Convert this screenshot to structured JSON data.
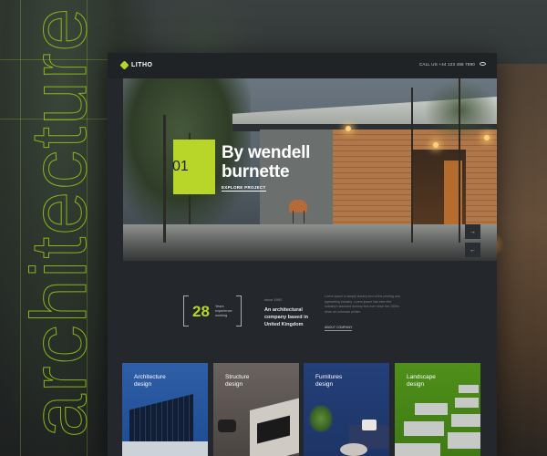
{
  "backdrop": {
    "vertical_word": "architecture"
  },
  "header": {
    "logo_text": "LITHO",
    "call_text": "CALL US +44 123 456 7890"
  },
  "hero": {
    "number": "01",
    "title_line1": "By wendell",
    "title_line2": "burnette",
    "cta": "EXPLORE PROJECT",
    "nav_next": "→",
    "nav_prev": "←"
  },
  "about": {
    "years": "28",
    "years_caption_lines": [
      "Years",
      "experience",
      "working"
    ],
    "label": "since 1992",
    "headline_lines": [
      "An architectural",
      "company based in",
      "United Kingdom"
    ],
    "paragraph": "Lorem ipsum is simply dummy text of the printing and typesetting industry. Lorem ipsum has been the industry's standard dummy text ever since the 1500s when an unknown printer.",
    "link": "ABOUT COMPANY"
  },
  "categories": [
    {
      "line1": "Architecture",
      "line2": "design"
    },
    {
      "line1": "Structure",
      "line2": "design"
    },
    {
      "line1": "Furnitures",
      "line2": "design"
    },
    {
      "line1": "Landscape",
      "line2": "design"
    }
  ],
  "colors": {
    "accent": "#b8d62a",
    "site_bg": "#24272b",
    "card_blue": "#2f5fa8",
    "card_green": "#4f8f1a"
  }
}
